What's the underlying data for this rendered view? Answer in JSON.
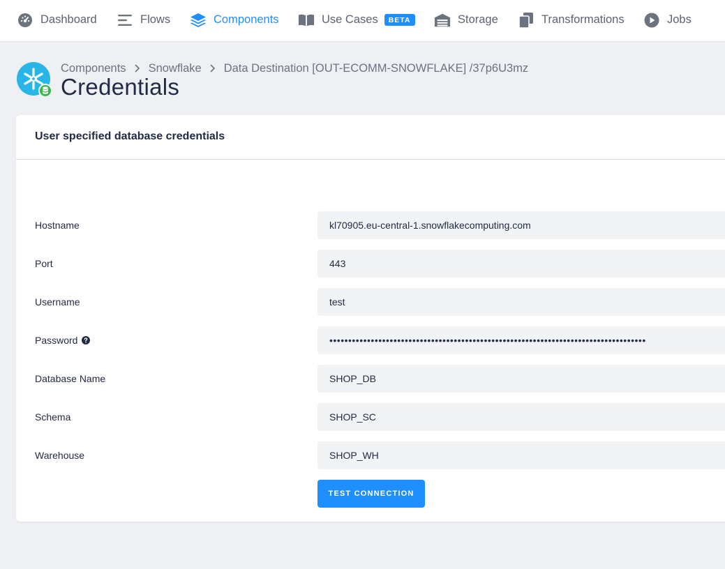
{
  "nav": {
    "items": [
      {
        "label": "Dashboard",
        "icon": "dashboard-gauge-icon"
      },
      {
        "label": "Flows",
        "icon": "flows-lines-icon"
      },
      {
        "label": "Components",
        "icon": "layers-icon",
        "active": true
      },
      {
        "label": "Use Cases",
        "icon": "book-open-icon",
        "badge": "BETA"
      },
      {
        "label": "Storage",
        "icon": "storage-warehouse-icon"
      },
      {
        "label": "Transformations",
        "icon": "copy-files-icon"
      },
      {
        "label": "Jobs",
        "icon": "play-circle-icon"
      }
    ]
  },
  "breadcrumb": {
    "items": [
      "Components",
      "Snowflake",
      "Data Destination [OUT-ECOMM-SNOWFLAKE] /37p6U3mz"
    ]
  },
  "page": {
    "title": "Credentials",
    "logo_icon": "snowflake-icon",
    "badge_icon": "database-icon"
  },
  "card": {
    "title": "User specified database credentials",
    "fields": [
      {
        "label": "Hostname",
        "value": "kl70905.eu-central-1.snowflakecomputing.com"
      },
      {
        "label": "Port",
        "value": "443"
      },
      {
        "label": "Username",
        "value": "test"
      },
      {
        "label": "Password",
        "value": "••••••••••••••••••••••••••••••••••••••••••••••••••••••••••••••••••••••••••••••••••••",
        "help_icon": "question-circle-icon"
      },
      {
        "label": "Database Name",
        "value": "SHOP_DB"
      },
      {
        "label": "Schema",
        "value": "SHOP_SC"
      },
      {
        "label": "Warehouse",
        "value": "SHOP_WH"
      }
    ],
    "test_button": "TEST CONNECTION"
  },
  "colors": {
    "accent": "#1f8fff",
    "nav_text": "#5b6272",
    "background": "#eef0f4",
    "input_bg": "#f2f3f5",
    "snowflake_brand": "#29b5e8",
    "badge_green": "#3bb54a"
  }
}
